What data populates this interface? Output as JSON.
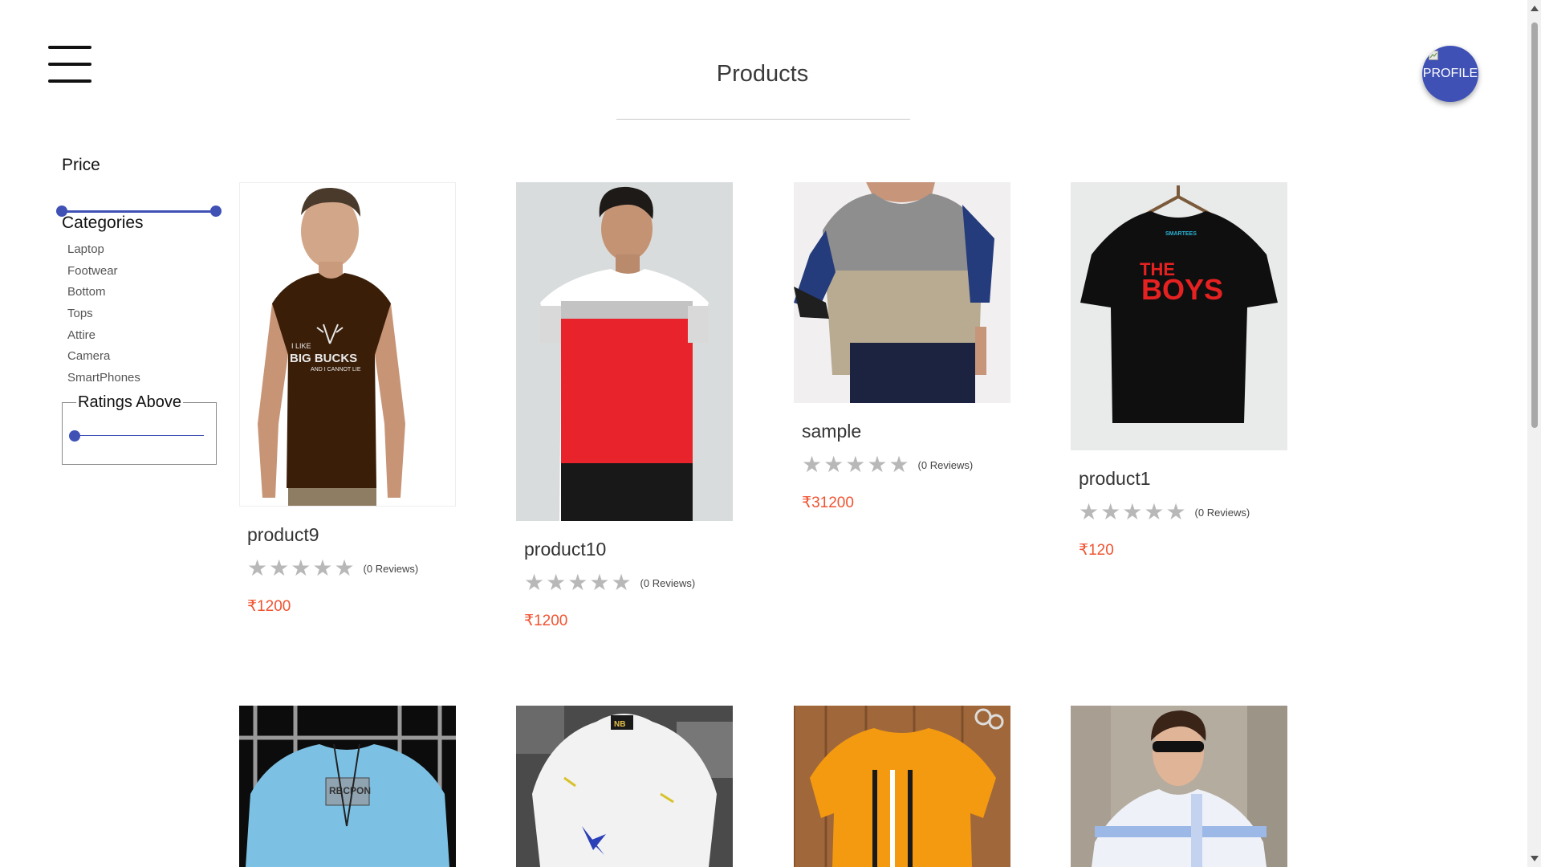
{
  "header": {
    "title": "Products",
    "profile_label": "PROFILE"
  },
  "filters": {
    "price_heading": "Price",
    "price_range_fraction": [
      0,
      1
    ],
    "categories_heading": "Categories",
    "categories": [
      "Laptop",
      "Footwear",
      "Bottom",
      "Tops",
      "Attire",
      "Camera",
      "SmartPhones"
    ],
    "ratings_heading": "Ratings Above",
    "ratings_value_fraction": 0
  },
  "products": [
    {
      "name": "product9",
      "reviews": "(0 Reviews)",
      "price": "₹1200",
      "rating": 0
    },
    {
      "name": "product10",
      "reviews": "(0 Reviews)",
      "price": "₹1200",
      "rating": 0
    },
    {
      "name": "sample",
      "reviews": "(0 Reviews)",
      "price": "₹31200",
      "rating": 0
    },
    {
      "name": "product1",
      "reviews": "(0 Reviews)",
      "price": "₹120",
      "rating": 0
    }
  ],
  "shirt_text": {
    "p9_line1": "I LIKE",
    "p9_line2": "BIG BUCKS",
    "p9_line3": "AND I CANNOT LIE",
    "p1_brand": "SMARTEES",
    "p1_line1": "THE",
    "p1_line2": "BOYS",
    "r2a_text": "RBCPON",
    "r2b_tag": "NB"
  },
  "colors": {
    "accent": "#3f51b5",
    "price": "#f05330",
    "star": "#b8b8b8"
  },
  "icons": {
    "menu": "hamburger-icon",
    "star": "star-icon"
  }
}
